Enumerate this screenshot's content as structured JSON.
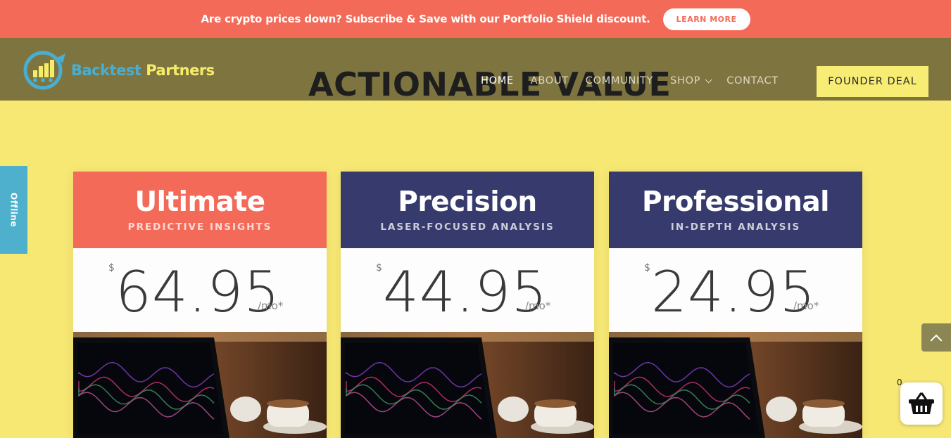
{
  "promo": {
    "text_before": "Are crypto prices down?",
    "strong1": "Subscribe & Save",
    "text_mid": "with our",
    "strong2": "Portfolio Shield",
    "text_after": "discount.",
    "button": "LEARN MORE"
  },
  "header": {
    "brand_part1": "Backtest",
    "brand_part2": "Partners",
    "hero_title": "ACTIONABLE VALUE",
    "nav": [
      {
        "label": "HOME",
        "active": true
      },
      {
        "label": "ABOUT"
      },
      {
        "label": "COMMUNITY"
      },
      {
        "label": "SHOP",
        "has_dropdown": true
      },
      {
        "label": "CONTACT"
      }
    ],
    "cta": "FOUNDER DEAL"
  },
  "sidebar": {
    "offline_label": "Offline"
  },
  "plans": [
    {
      "name": "Ultimate",
      "subtitle": "PREDICTIVE INSIGHTS",
      "currency": "$",
      "price": "64.95",
      "period": "/mo*",
      "header_color": "#f46a59"
    },
    {
      "name": "Precision",
      "subtitle": "LASER-FOCUSED ANALYSIS",
      "currency": "$",
      "price": "44.95",
      "period": "/mo*",
      "header_color": "#373a6d"
    },
    {
      "name": "Professional",
      "subtitle": "IN-DEPTH ANALYSIS",
      "currency": "$",
      "price": "24.95",
      "period": "/mo*",
      "header_color": "#373a6d"
    }
  ],
  "cart": {
    "count": "0",
    "icon": "basket-icon"
  },
  "scroll_top": {
    "icon": "chevron-up-icon"
  },
  "colors": {
    "promo_bg": "#f46a59",
    "header_bg": "#7e7440",
    "page_bg": "#f7e874",
    "accent_yellow": "#f7ec74",
    "navy": "#373a6d",
    "offline_tab": "#4eb0cc"
  }
}
